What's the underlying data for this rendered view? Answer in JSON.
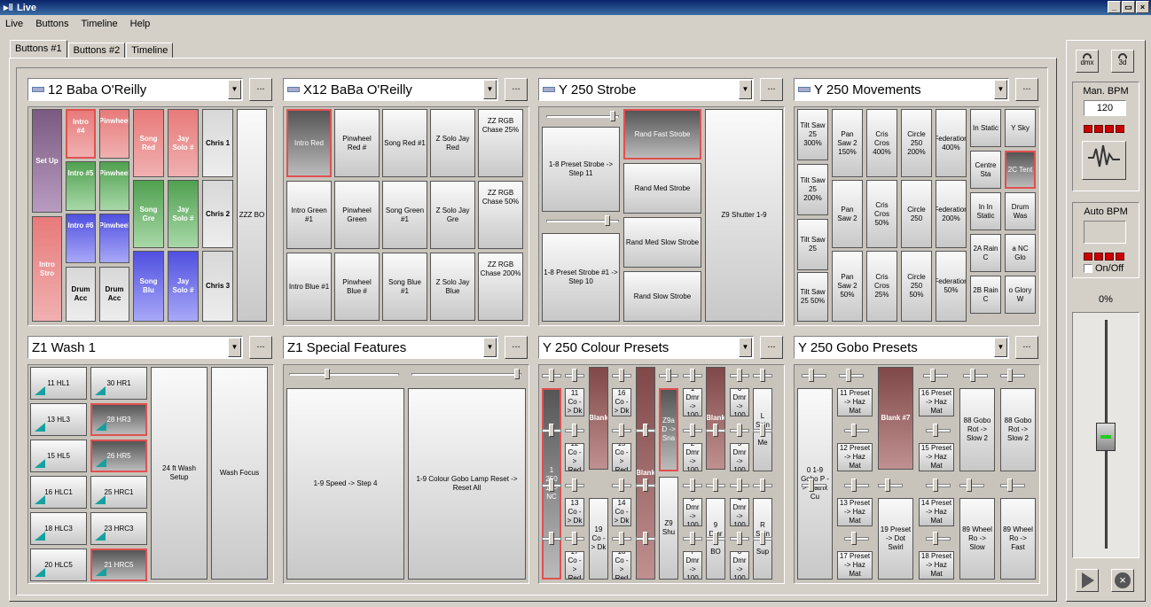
{
  "window": {
    "title": "Live",
    "minimize": "_",
    "restore": "▭",
    "close": "×"
  },
  "menu": [
    "Live",
    "Buttons",
    "Timeline",
    "Help"
  ],
  "tabs": [
    "Buttons #1",
    "Buttons #2",
    "Timeline"
  ],
  "sections": [
    {
      "title": "12 Baba O'Reilly",
      "ellipsis": "...",
      "buttons": [
        "Set Up",
        "Intro #4",
        "Pinwheel",
        "Song Red",
        "Jay Solo #",
        "Chris 1",
        "Intro #5",
        "Pinwheel",
        "Song Gre",
        "Jay Solo #",
        "Chris 2",
        "ZZZ BO",
        "Intro Stro",
        "Intro #6",
        "Pinwheel",
        "Drum Acc",
        "Drum Acc",
        "Song Blu",
        "Jay Solo #",
        "Chris 3"
      ]
    },
    {
      "title": "X12 BaBa O'Reilly",
      "ellipsis": "...",
      "buttons": [
        "Intro Red",
        "Pinwheel Red #",
        "Song Red #1",
        "Z Solo Jay Red",
        "ZZ RGB Chase 25%",
        "Intro Green #1",
        "Pinwheel Green",
        "Song Green #1",
        "Z Solo Jay Gre",
        "ZZ RGB Chase 50%",
        "Intro Blue #1",
        "Pinwheel Blue #",
        "Song Blue #1",
        "Z Solo Jay Blue",
        "ZZ RGB Chase 200%"
      ]
    },
    {
      "title": "Y 250 Strobe",
      "ellipsis": "...",
      "buttons": [
        "1-8 Preset Strobe -> Step 11",
        "1-8 Preset Strobe #1 -> Step 10",
        "Rand Fast Strobe",
        "Rand Med Strobe",
        "Rand Med Slow Strobe",
        "Rand Slow Strobe",
        "Z9 Shutter 1-9"
      ]
    },
    {
      "title": "Y 250 Movements",
      "ellipsis": "...",
      "buttons": [
        "Tilt Saw 25 300%",
        "Pan Saw 2 150%",
        "Cris Cros 400%",
        "Circle 250 200%",
        "Federation 400%",
        "In Static",
        "Y Sky",
        "Tilt Saw 25 200%",
        "Centre Sta",
        "2C Tent",
        "Pan Saw 2",
        "Cris Cros 50%",
        "Circle 250",
        "Federation 200%",
        "In In Static",
        "Drum Was",
        "Tilt Saw 25",
        "2A Rain C",
        "a NC Glo",
        "Tilt Saw 25 50%",
        "Pan Saw 2 50%",
        "Cris Cros 25%",
        "Circle 250 50%",
        "Federation 50%",
        "2B Rain C",
        "o Glory W"
      ]
    },
    {
      "title": "Z1 Wash 1",
      "ellipsis": "...",
      "buttons": [
        "11 HL1",
        "30 HR1",
        "13 HL3",
        "28 HR3",
        "15 HL5",
        "26 HR5",
        "16 HLC1",
        "25 HRC1",
        "18 HLC3",
        "23 HRC3",
        "20 HLC5",
        "21 HRC5",
        "24 ft Wash Setup",
        "Wash Focus"
      ]
    },
    {
      "title": "Z1 Special Features",
      "ellipsis": "...",
      "buttons": [
        "1-9 Speed -> Step 4",
        "1-9 Colour Gobo Lamp Reset -> Reset All"
      ]
    },
    {
      "title": "Y 250 Colour Presets",
      "ellipsis": "...",
      "buttons": [
        "1 250 1 -> NC",
        "11 Co -> Dk",
        "Blank",
        "16 Co -> Dk",
        "Blank",
        "Z9a D -> Sna",
        "1 Dmr -> 100",
        "Blank",
        "6 Dmr -> 100",
        "L Spin -> Me",
        "12 Co -> Red",
        "15 Co -> Red",
        "2 Dmr -> 100",
        "5 Dmr -> 100",
        "13 Co -> Dk",
        "19 Co -> Dk",
        "14 Co -> Dk",
        "Z9 Shu",
        "3 Dmr -> 100",
        "9 Dmr -> BO",
        "4 Dmr -> 100",
        "R Spin -> Sup",
        "17 Co -> Red",
        "18 Co -> Red",
        "7 Dmr -> 100",
        "8 Dmr -> 100"
      ]
    },
    {
      "title": "Y 250 Gobo Presets",
      "ellipsis": "...",
      "buttons": [
        "0 1-9 Gobo P -> Matrix Cu",
        "11 Preset -> Haz Mat",
        "Blank #7",
        "16 Preset -> Haz Mat",
        "88 Gobo Rot -> Slow 2",
        "88 Gobo Rot -> Slow 2",
        "12 Preset -> Haz Mat",
        "15 Preset -> Haz Mat",
        "13 Preset -> Haz Mat",
        "19 Preset -> Dot Swirl",
        "14 Preset -> Haz Mat",
        "89 Wheel Ro -> Slow",
        "89 Wheel Ro -> Fast",
        "17 Preset -> Haz Mat",
        "18 Preset -> Haz Mat"
      ]
    }
  ],
  "right": {
    "dmx": "dmx",
    "three_d": "3d",
    "man_bpm_label": "Man. BPM",
    "man_bpm_value": "120",
    "auto_bpm_label": "Auto BPM",
    "onoff": "On/Off",
    "percent": "0%"
  }
}
